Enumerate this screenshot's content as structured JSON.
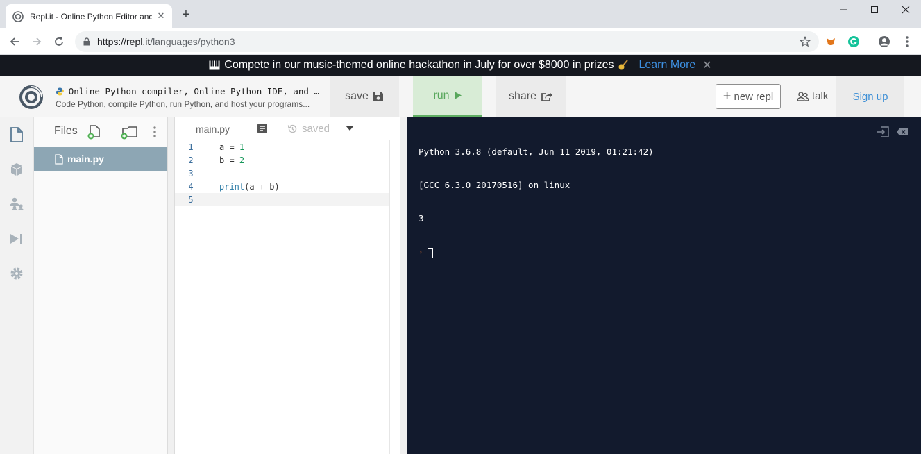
{
  "browser": {
    "tab_title": "Repl.it - Online Python Editor and",
    "tab_close": "✕",
    "new_tab": "+",
    "url_host": "https://repl.it",
    "url_path": "/languages/python3"
  },
  "banner": {
    "text": "Compete in our music-themed online hackathon in July for over $8000 in prizes",
    "link": "Learn More",
    "close": "✕"
  },
  "header": {
    "title": "Online Python compiler, Online Python IDE, and …",
    "description": "Code Python, compile Python, run Python, and host your programs...",
    "save_label": "save",
    "run_label": "run",
    "share_label": "share",
    "new_repl_label": "new repl",
    "new_repl_plus": "+",
    "talk_label": "talk",
    "signup_label": "Sign up"
  },
  "files": {
    "heading": "Files",
    "items": [
      {
        "name": "main.py",
        "selected": true
      }
    ]
  },
  "editor": {
    "tab": "main.py",
    "status": "saved",
    "lines": [
      {
        "n": "1"
      },
      {
        "n": "2"
      },
      {
        "n": "3"
      },
      {
        "n": "4"
      },
      {
        "n": "5"
      }
    ],
    "code": {
      "l1_var": "a = ",
      "l1_num": "1",
      "l2_var": "b = ",
      "l2_num": "2",
      "l4_kw": "print",
      "l4_rest": "(a + b)"
    }
  },
  "console": {
    "line1": "Python 3.6.8 (default, Jun 11 2019, 01:21:42)",
    "line2": "[GCC 6.3.0 20170516] on linux",
    "line3": "3",
    "prompt": "›"
  },
  "colors": {
    "banner_bg": "#15181f",
    "console_bg": "#121a2d",
    "run_green": "#58a75c",
    "link_blue": "#3d8fe0",
    "selected_file": "#8da6b4"
  }
}
